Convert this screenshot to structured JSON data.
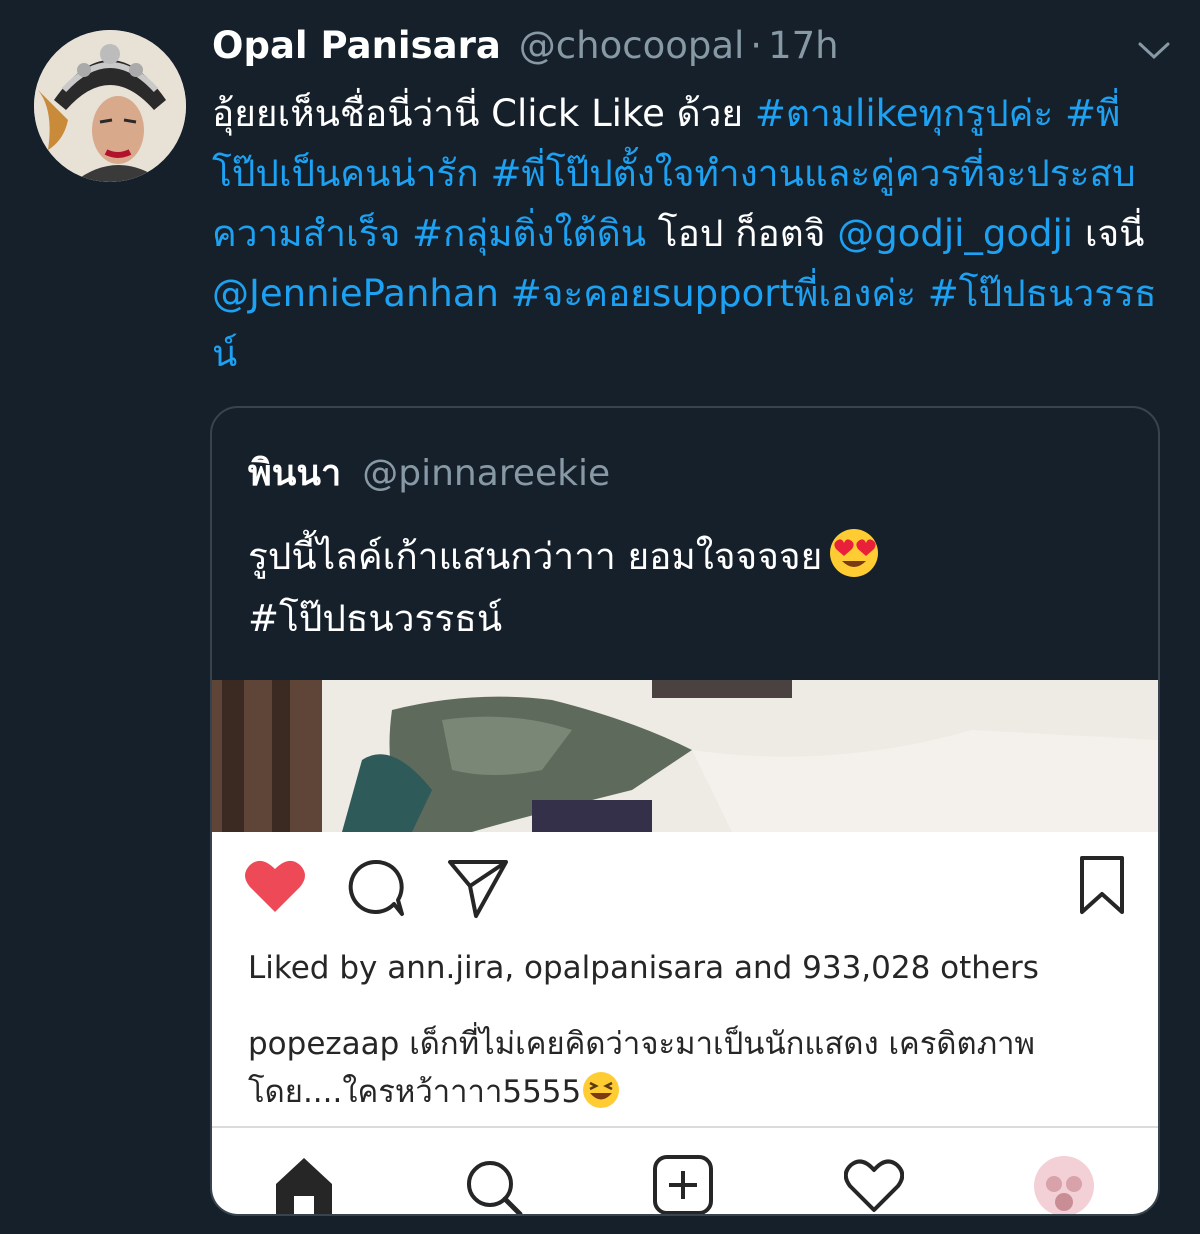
{
  "tweet": {
    "author_name": "Opal Panisara",
    "author_handle": "@chocoopal",
    "separator": "·",
    "time": "17h",
    "text_plain_1": "อุ้ยยเห็นชื่อนี่ว่านี่ Click Like ด้วย ",
    "hashtag_1": "#ตามlikeทุกรูปค่ะ",
    "hashtag_2": "#พี่โป๊ปเป็นคนน่ารัก",
    "hashtag_3": "#พี่โป๊ปตั้งใจทำงานและคู่ควรที่จะประสบความสำเร็จ",
    "hashtag_4": "#กลุ่มติ่งใต้ดิน",
    "text_plain_2": " โอป ก็อตจิ ",
    "mention_1": "@godji_godji",
    "text_plain_3": " เจนี่ ",
    "mention_2": "@JenniePanhan",
    "hashtag_5": "#จะคอยsupportพี่เองค่ะ",
    "hashtag_6": "#โป๊ปธนวรรธน์"
  },
  "quote": {
    "author_name": "พินนา",
    "author_handle": "@pinnareekie",
    "text_line_1": "รูปนี้ไลค์เก้าแสนกว่าาา ยอมใจจจจย",
    "text_line_2": "#โป๊ปธนวรรธน์"
  },
  "instagram": {
    "liked_by": "Liked by ann.jira, opalpanisara and 933,028 others",
    "caption_user": "popezaap",
    "caption_text": " เด็กที่ไม่เคยคิดว่าจะมาเป็นนักแสดง เครดิตภาพ โดย....ใครหว้าาาา5555",
    "icons": {
      "like": "heart-filled-icon",
      "comment": "comment-icon",
      "share": "send-icon",
      "save": "bookmark-icon",
      "nav": [
        "home-icon",
        "search-icon",
        "add-post-icon",
        "activity-heart-icon",
        "profile-avatar"
      ]
    },
    "accent_like": "#ed4956"
  },
  "colors": {
    "background": "#15202b",
    "link": "#1da1f2",
    "muted": "#8899a6",
    "border": "#38444d"
  }
}
